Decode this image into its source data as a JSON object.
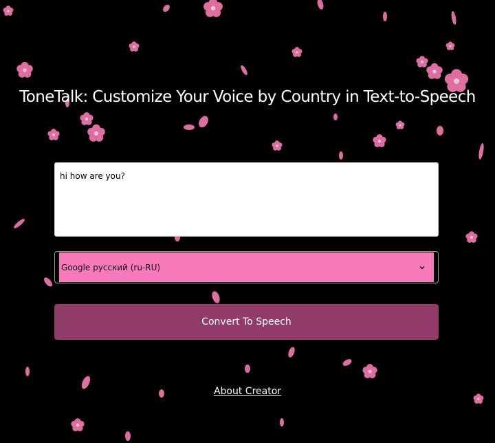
{
  "page": {
    "title": "ToneTalk: Customize Your Voice by Country in Text-to-Speech",
    "background_color": "#000000",
    "petal_color": "#f277b1"
  },
  "form": {
    "text_input_value": "hi how are you?",
    "voice_select_value": "Google русский (ru-RU)",
    "voice_select_color": "#f77bbb",
    "convert_label": "Convert To Speech",
    "convert_color": "#913b69"
  },
  "footer": {
    "about_link": "About Creator"
  }
}
